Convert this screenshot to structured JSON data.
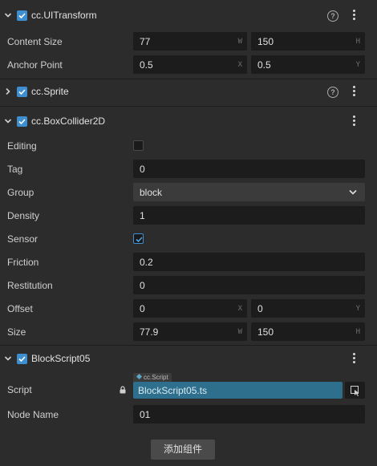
{
  "components": {
    "ui_transform": {
      "title": "cc.UITransform",
      "help_icon": "?",
      "content_size": {
        "label": "Content Size",
        "w": "77",
        "w_unit": "W",
        "h": "150",
        "h_unit": "H"
      },
      "anchor_point": {
        "label": "Anchor Point",
        "x": "0.5",
        "x_unit": "X",
        "y": "0.5",
        "y_unit": "Y"
      }
    },
    "sprite": {
      "title": "cc.Sprite",
      "help_icon": "?"
    },
    "box_collider": {
      "title": "cc.BoxCollider2D",
      "editing": {
        "label": "Editing",
        "checked": false
      },
      "tag": {
        "label": "Tag",
        "value": "0"
      },
      "group": {
        "label": "Group",
        "value": "block"
      },
      "density": {
        "label": "Density",
        "value": "1"
      },
      "sensor": {
        "label": "Sensor",
        "checked": true
      },
      "friction": {
        "label": "Friction",
        "value": "0.2"
      },
      "restitution": {
        "label": "Restitution",
        "value": "0"
      },
      "offset": {
        "label": "Offset",
        "x": "0",
        "x_unit": "X",
        "y": "0",
        "y_unit": "Y"
      },
      "size": {
        "label": "Size",
        "w": "77.9",
        "w_unit": "W",
        "h": "150",
        "h_unit": "H"
      }
    },
    "block_script": {
      "title": "BlockScript05",
      "script": {
        "label": "Script",
        "asset_type": "cc.Script",
        "value": "BlockScript05.ts"
      },
      "node_name": {
        "label": "Node Name",
        "value": "01"
      }
    }
  },
  "add_component_label": "添加组件",
  "colors": {
    "accent": "#3f8fd0",
    "asset": "#2d6f8d",
    "background": "#2c2c2c",
    "field": "#1c1c1c"
  },
  "icons": [
    "chevron-down-icon",
    "chevron-right-icon",
    "check-icon",
    "help-icon",
    "more-vertical-icon",
    "lock-icon",
    "asset-picker-icon",
    "dropdown-arrow-icon"
  ]
}
